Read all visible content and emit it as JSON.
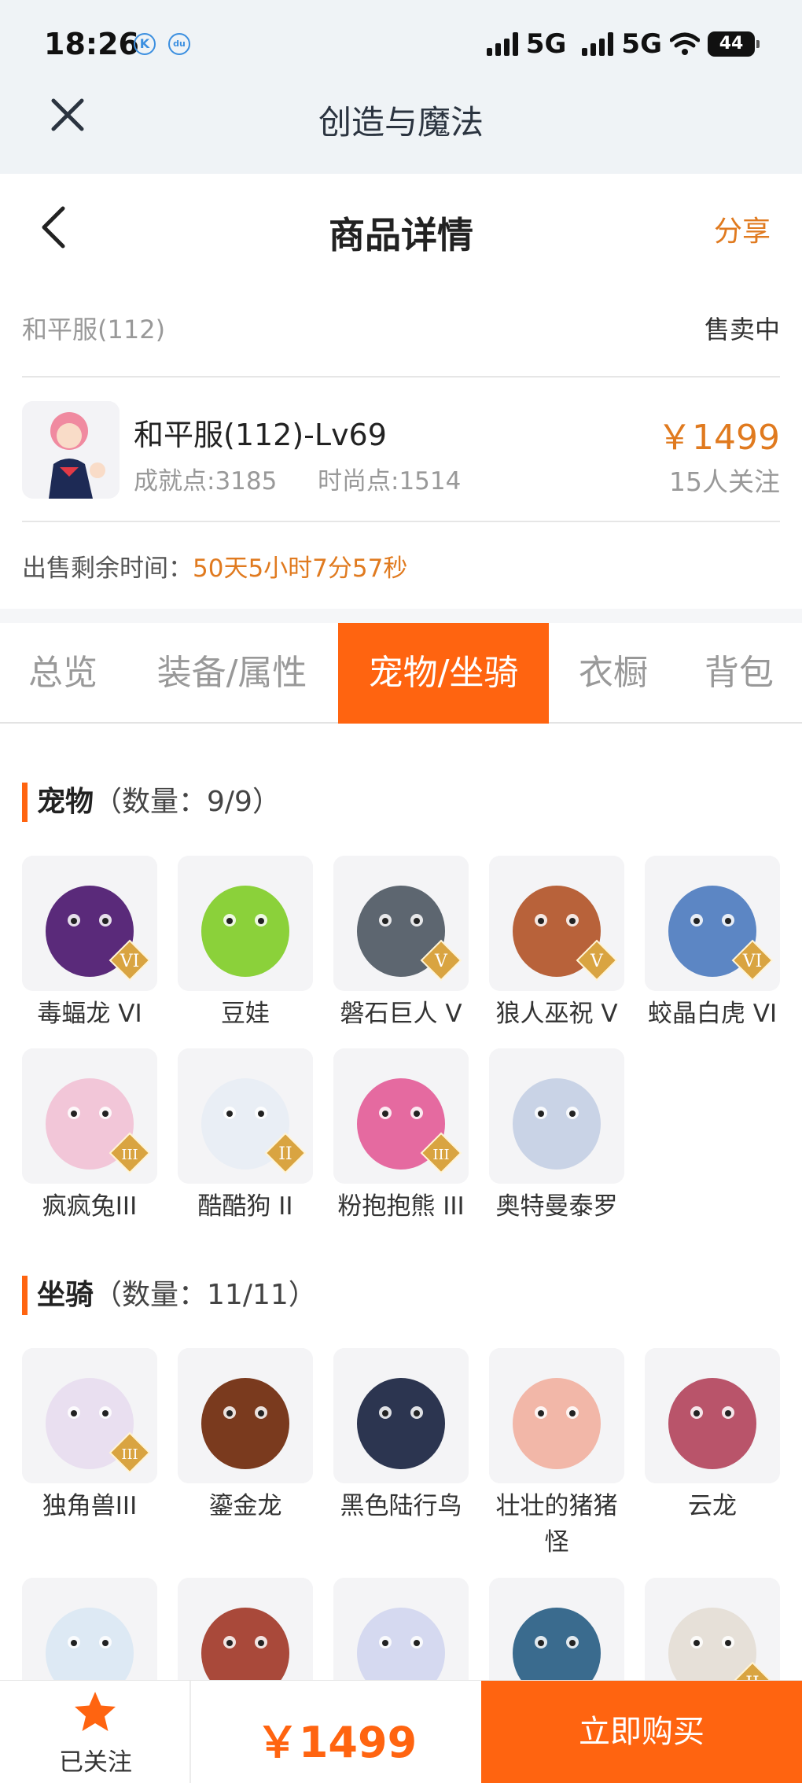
{
  "status_bar": {
    "time": "18:26",
    "network1": "5G",
    "network2": "5G",
    "battery": "44",
    "badge1": "K",
    "badge2": "du"
  },
  "window": {
    "title": "创造与魔法"
  },
  "header": {
    "title": "商品详情",
    "share_label": "分享"
  },
  "listing": {
    "server": "和平服(112)",
    "status": "售卖中",
    "role_name": "和平服(112)-Lv69",
    "achievement": "成就点:3185",
    "fashion": "时尚点:1514",
    "price": "￥1499",
    "followers": "15人关注",
    "remain_label": "出售剩余时间：",
    "remain_value": "50天5小时7分57秒"
  },
  "tabs": [
    {
      "label": "总览"
    },
    {
      "label": "装备/属性"
    },
    {
      "label": "宠物/坐骑"
    },
    {
      "label": "衣橱"
    },
    {
      "label": "背包"
    }
  ],
  "pets_section": {
    "title": "宠物",
    "count": "（数量：9/9）"
  },
  "pets": [
    {
      "name": "毒蝠龙 VI",
      "tier": "VI",
      "color": "#5a2a7a"
    },
    {
      "name": "豆娃",
      "tier": "",
      "color": "#8bd13a"
    },
    {
      "name": "磐石巨人 V",
      "tier": "V",
      "color": "#5d6670"
    },
    {
      "name": "狼人巫祝 V",
      "tier": "V",
      "color": "#b8623a"
    },
    {
      "name": "蛟晶白虎 VI",
      "tier": "VI",
      "color": "#5c86c4"
    },
    {
      "name": "疯疯兔III",
      "tier": "III",
      "color": "#f2c6d8"
    },
    {
      "name": "酷酷狗 II",
      "tier": "II",
      "color": "#e9eef5"
    },
    {
      "name": "粉抱抱熊 III",
      "tier": "III",
      "color": "#e56aa0"
    },
    {
      "name": "奥特曼泰罗",
      "tier": "",
      "color": "#c9d3e6"
    }
  ],
  "mounts_section": {
    "title": "坐骑",
    "count": "（数量：11/11）"
  },
  "mounts": [
    {
      "name": "独角兽III",
      "tier": "III",
      "color": "#e9dff0"
    },
    {
      "name": "鎏金龙",
      "tier": "",
      "color": "#7a3a1e"
    },
    {
      "name": "黑色陆行鸟",
      "tier": "",
      "color": "#2c3550"
    },
    {
      "name": "壮壮的猪猪怪",
      "tier": "",
      "color": "#f2b7a8"
    },
    {
      "name": "云龙",
      "tier": "",
      "color": "#b9546a"
    },
    {
      "name": "",
      "tier": "",
      "color": "#dde9f4"
    },
    {
      "name": "",
      "tier": "",
      "color": "#a9493a"
    },
    {
      "name": "",
      "tier": "",
      "color": "#d5d9f0"
    },
    {
      "name": "",
      "tier": "",
      "color": "#3a6b8e"
    },
    {
      "name": "",
      "tier": "II",
      "color": "#e6e0d8"
    }
  ],
  "bottom_bar": {
    "follow_label": "已关注",
    "price": "￥1499",
    "buy_label": "立即购买"
  },
  "accent_color": "#ff6410"
}
